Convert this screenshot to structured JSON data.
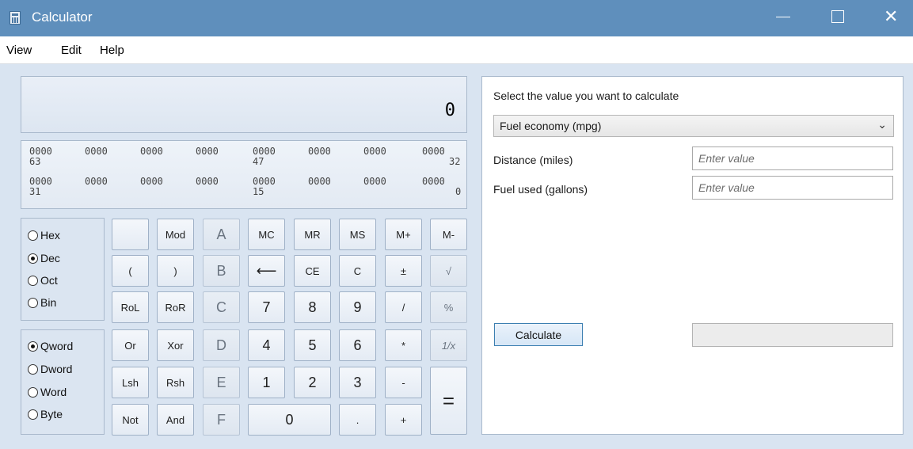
{
  "window": {
    "title": "Calculator",
    "close_glyph": "✕"
  },
  "menu": [
    "View",
    "Edit",
    "Help"
  ],
  "display": {
    "value": "0"
  },
  "bits": {
    "row1": [
      "0000",
      "0000",
      "0000",
      "0000",
      "0000",
      "0000",
      "0000",
      "0000"
    ],
    "row1_marks": [
      "63",
      "47",
      "32"
    ],
    "row2": [
      "0000",
      "0000",
      "0000",
      "0000",
      "0000",
      "0000",
      "0000",
      "0000"
    ],
    "row2_marks": [
      "31",
      "15",
      "0"
    ]
  },
  "base_options": [
    {
      "label": "Hex",
      "selected": false
    },
    {
      "label": "Dec",
      "selected": true
    },
    {
      "label": "Oct",
      "selected": false
    },
    {
      "label": "Bin",
      "selected": false
    }
  ],
  "word_options": [
    {
      "label": "Qword",
      "selected": true
    },
    {
      "label": "Dword",
      "selected": false
    },
    {
      "label": "Word",
      "selected": false
    },
    {
      "label": "Byte",
      "selected": false
    }
  ],
  "keys": {
    "blank": "",
    "mod": "Mod",
    "a": "A",
    "mc": "MC",
    "mr": "MR",
    "ms": "MS",
    "mplus": "M+",
    "mminus": "M-",
    "lparen": "(",
    "rparen": ")",
    "b": "B",
    "back": "⟵",
    "ce": "CE",
    "c": "C",
    "plusminus": "±",
    "sqrt": "√",
    "rol": "RoL",
    "ror": "RoR",
    "hc": "C",
    "k7": "7",
    "k8": "8",
    "k9": "9",
    "div": "/",
    "pct": "%",
    "or": "Or",
    "xor": "Xor",
    "d": "D",
    "k4": "4",
    "k5": "5",
    "k6": "6",
    "mul": "*",
    "recip": "1/x",
    "lsh": "Lsh",
    "rsh": "Rsh",
    "e": "E",
    "k1": "1",
    "k2": "2",
    "k3": "3",
    "minus": "-",
    "eq": "=",
    "not": "Not",
    "and": "And",
    "f": "F",
    "k0": "0",
    "dot": ".",
    "plus": "+"
  },
  "panel": {
    "title": "Select the value you want to calculate",
    "mode": "Fuel economy (mpg)",
    "distance_label": "Distance (miles)",
    "distance_placeholder": "Enter value",
    "fuel_label": "Fuel used (gallons)",
    "fuel_placeholder": "Enter value",
    "calculate_label": "Calculate"
  }
}
